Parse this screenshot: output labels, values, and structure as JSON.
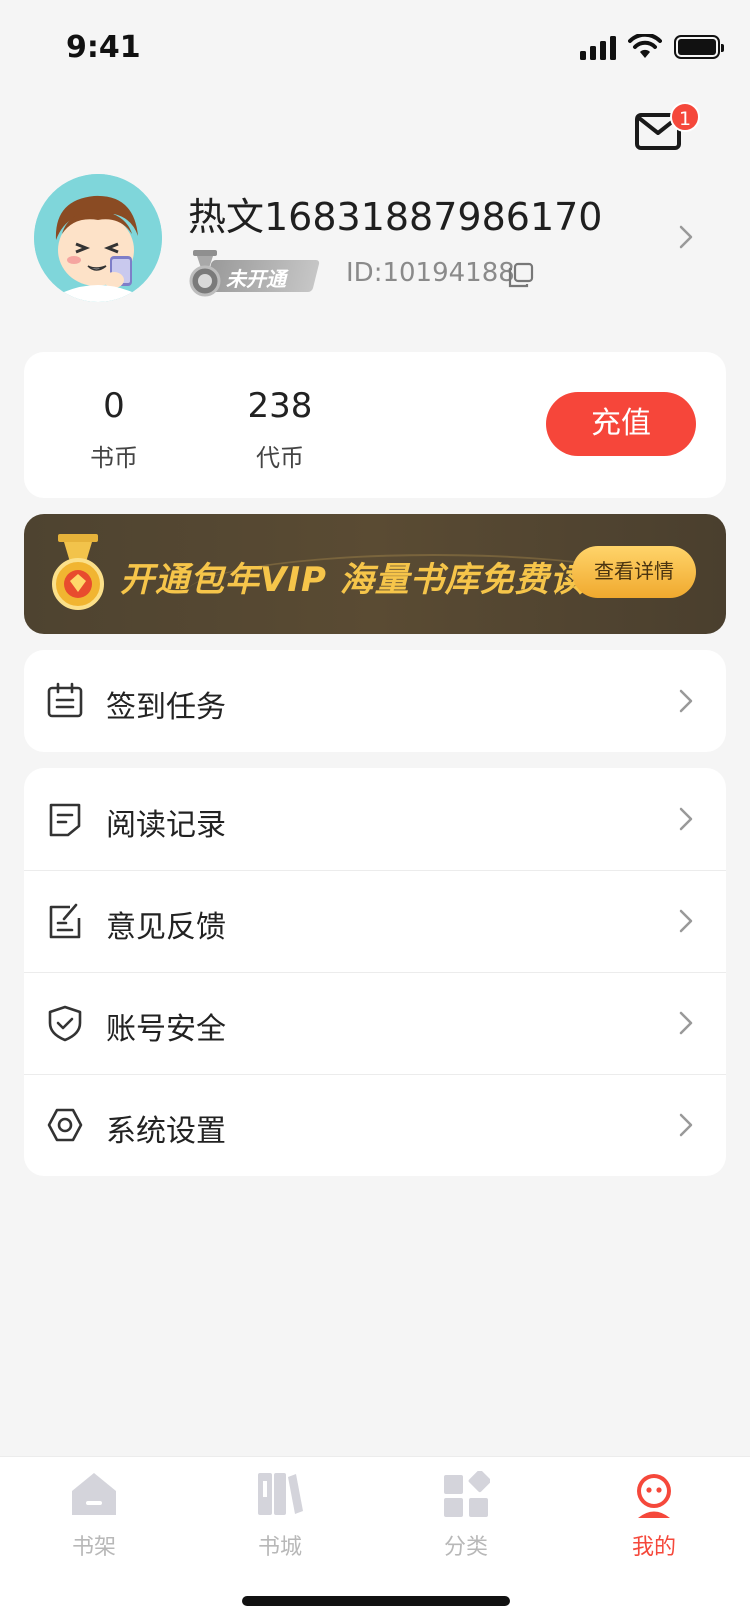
{
  "status_bar": {
    "time": "9:41"
  },
  "header": {
    "unread_count": "1"
  },
  "profile": {
    "username": "热文16831887986170",
    "vip_status": "未开通",
    "user_id": "ID:10194188"
  },
  "wallet": {
    "book_coins_value": "0",
    "book_coins_label": "书币",
    "voucher_value": "238",
    "voucher_label": "代币",
    "recharge_label": "充值"
  },
  "vip_banner": {
    "promo_text": "开通包年VIP  海量书库免费读",
    "detail_label": "查看详情"
  },
  "menu": {
    "checkin": "签到任务",
    "items": [
      {
        "label": "阅读记录",
        "icon": "reading-record-icon"
      },
      {
        "label": "意见反馈",
        "icon": "feedback-icon"
      },
      {
        "label": "账号安全",
        "icon": "shield-icon"
      },
      {
        "label": "系统设置",
        "icon": "settings-icon"
      }
    ]
  },
  "tabbar": {
    "tabs": [
      {
        "label": "书架",
        "icon": "bookshelf-icon"
      },
      {
        "label": "书城",
        "icon": "bookstore-icon"
      },
      {
        "label": "分类",
        "icon": "category-icon"
      },
      {
        "label": "我的",
        "icon": "profile-icon",
        "active": true
      }
    ],
    "active_color": "#f5483b",
    "inactive_color": "#b8b8b8"
  },
  "colors": {
    "accent": "#f6463a",
    "vip_gold": "#f6c54a",
    "background": "#f5f5f5"
  }
}
